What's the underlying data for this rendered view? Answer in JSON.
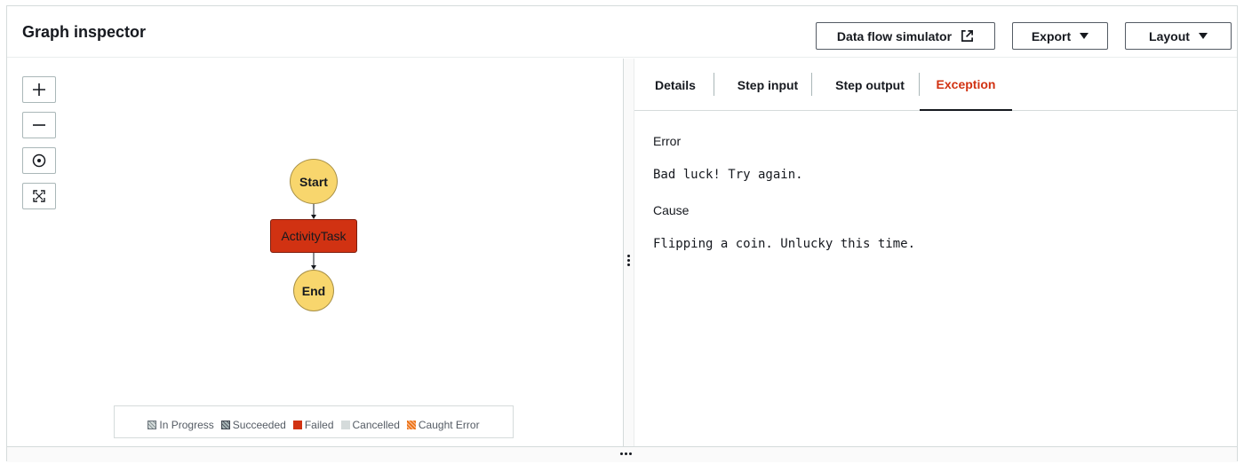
{
  "header": {
    "title": "Graph inspector",
    "buttons": {
      "simulator_label": "Data flow simulator",
      "export_label": "Export",
      "layout_label": "Layout"
    }
  },
  "graph": {
    "zoom_controls": [
      "zoom-in-icon",
      "zoom-out-icon",
      "center-icon",
      "fit-to-screen-icon"
    ],
    "nodes": {
      "start": "Start",
      "task": "ActivityTask",
      "end": "End"
    },
    "colors": {
      "node_circle": "#f8d66d",
      "node_failed": "#d13212",
      "accent_exception": "#d13212"
    },
    "legend": [
      {
        "label": "In Progress",
        "swatch": "in-progress"
      },
      {
        "label": "Succeeded",
        "swatch": "succeeded"
      },
      {
        "label": "Failed",
        "swatch": "failed"
      },
      {
        "label": "Cancelled",
        "swatch": "cancelled"
      },
      {
        "label": "Caught Error",
        "swatch": "caught-error"
      }
    ]
  },
  "tabs": [
    {
      "label": "Details"
    },
    {
      "label": "Step input"
    },
    {
      "label": "Step output"
    },
    {
      "label": "Exception",
      "active": true
    }
  ],
  "exception": {
    "error_label": "Error",
    "error_value": "Bad luck! Try again.",
    "cause_label": "Cause",
    "cause_value": "Flipping a coin. Unlucky this time."
  }
}
